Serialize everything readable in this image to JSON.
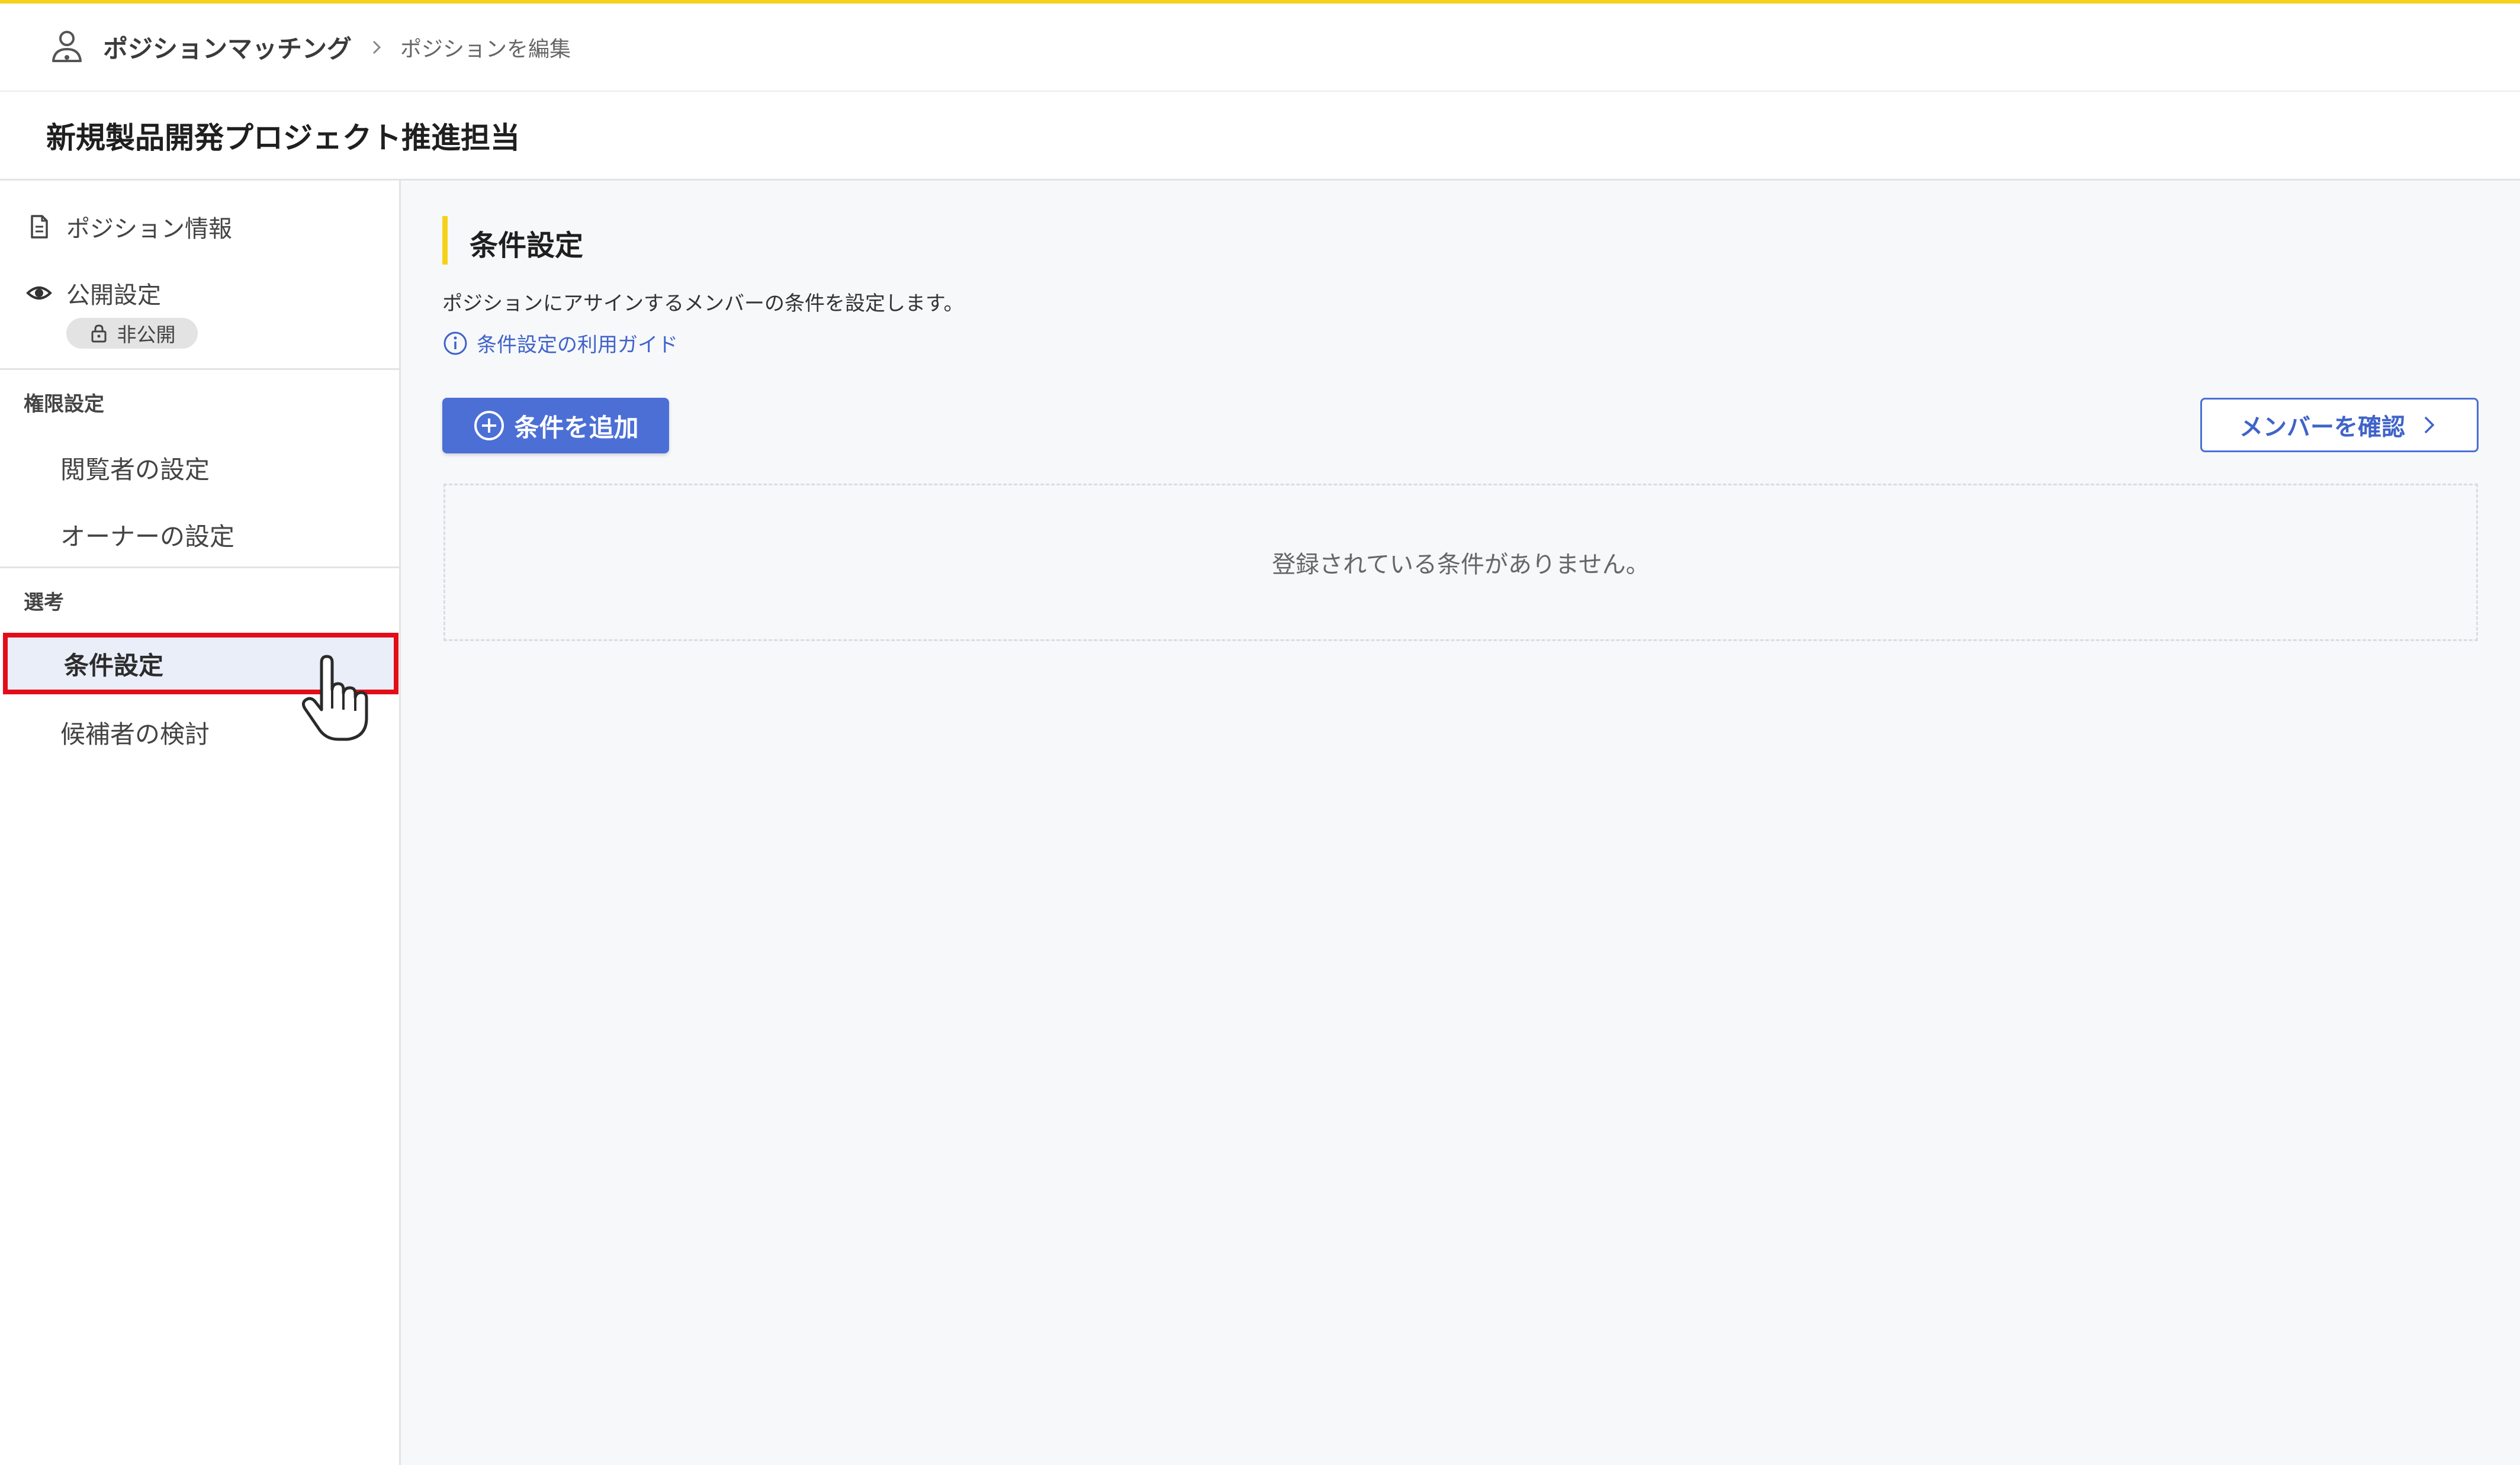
{
  "header": {
    "app_name": "ポジションマッチング",
    "current": "ポジションを編集"
  },
  "page": {
    "title": "新規製品開発プロジェクト推進担当"
  },
  "sidebar": {
    "position_info": "ポジション情報",
    "publish_setting": "公開設定",
    "publish_badge": "非公開",
    "permissions_heading": "権限設定",
    "viewer_setting": "閲覧者の設定",
    "owner_setting": "オーナーの設定",
    "selection_heading": "選考",
    "condition_setting": "条件設定",
    "candidate_review": "候補者の検討"
  },
  "main": {
    "section_title": "条件設定",
    "description": "ポジションにアサインするメンバーの条件を設定します。",
    "guide_link": "条件設定の利用ガイド",
    "add_button": "条件を追加",
    "members_button": "メンバーを確認",
    "empty_message": "登録されている条件がありません。"
  },
  "colors": {
    "accent_yellow": "#f5d21a",
    "primary_blue": "#4c6fd6",
    "highlight_red": "#e30d1a",
    "active_bg": "#e9eef8"
  }
}
